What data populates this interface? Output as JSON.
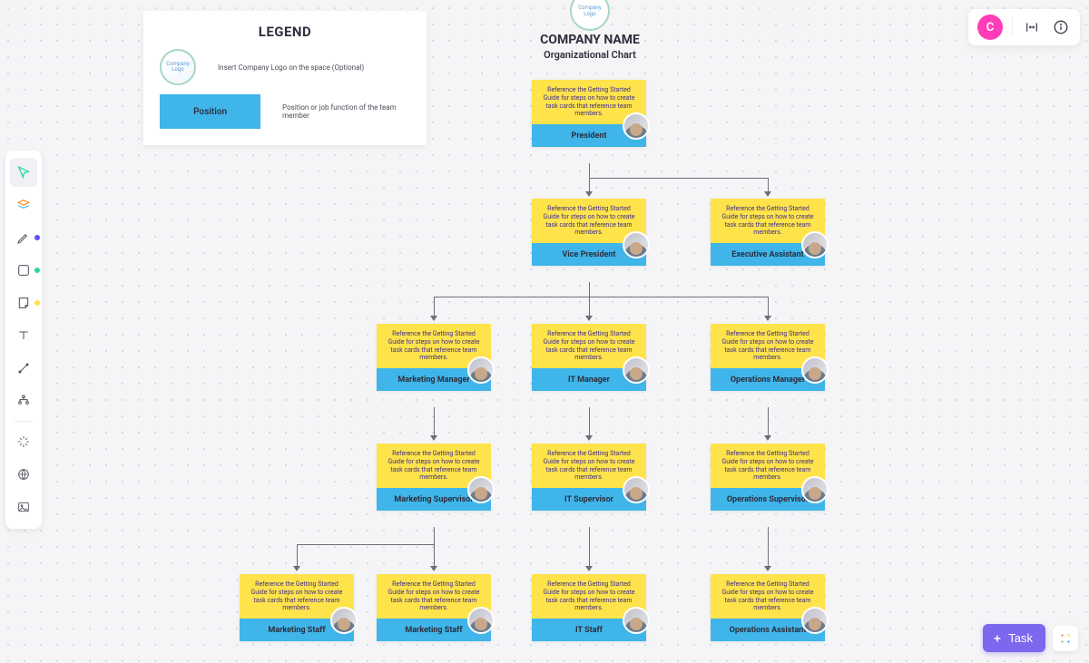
{
  "user_avatar_letter": "C",
  "task_button_label": "Task",
  "legend": {
    "heading": "LEGEND",
    "logo_text": "Company Logo",
    "logo_desc": "Insert Company Logo on the space (Optional)",
    "position_label": "Position",
    "position_desc": "Position or job function of the team member"
  },
  "company": {
    "logo_text": "Company Logo",
    "name": "COMPANY NAME",
    "subtitle": "Organizational Chart"
  },
  "node_desc": "Reference the Getting Started Guide for steps on how to create task cards that reference team members.",
  "nodes": {
    "president": "President",
    "vp": "Vice President",
    "ea": "Executive Assistant",
    "mkt_mgr": "Marketing Manager",
    "it_mgr": "IT Manager",
    "ops_mgr": "Operations Manager",
    "mkt_sup": "Marketing Supervisor",
    "it_sup": "IT Supervisor",
    "ops_sup": "Operations Supervisor",
    "mkt_staff1": "Marketing Staff",
    "mkt_staff2": "Marketing Staff",
    "it_staff": "IT Staff",
    "ops_asst": "Operations Assistant"
  }
}
